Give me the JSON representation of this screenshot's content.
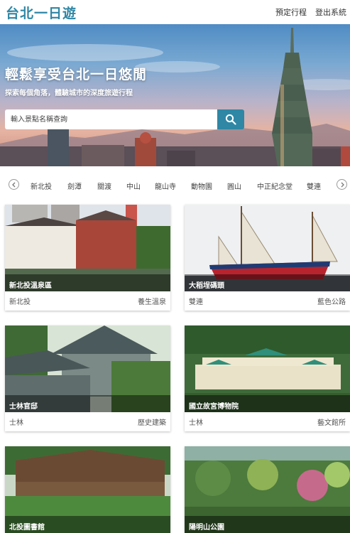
{
  "header": {
    "brand": "台北一日遊",
    "nav": [
      "預定行程",
      "登出系統"
    ]
  },
  "hero": {
    "title": "輕鬆享受台北一日悠閒",
    "subtitle": "探索每個角落，體驗城市的深度旅遊行程",
    "search_placeholder": "輸入景點名稱查詢"
  },
  "categories": [
    "新北投",
    "劍潭",
    "關渡",
    "中山",
    "龍山寺",
    "動物園",
    "圓山",
    "中正紀念堂",
    "雙連"
  ],
  "cards": [
    {
      "title": "新北投溫泉區",
      "area": "新北投",
      "tag": "養生溫泉"
    },
    {
      "title": "大稻埕碼頭",
      "area": "雙連",
      "tag": "藍色公路"
    },
    {
      "title": "士林官邸",
      "area": "士林",
      "tag": "歷史建築"
    },
    {
      "title": "國立故宮博物院",
      "area": "士林",
      "tag": "藝文館所"
    },
    {
      "title": "北投圖書館",
      "area": "",
      "tag": ""
    },
    {
      "title": "陽明山公園",
      "area": "",
      "tag": ""
    }
  ],
  "colors": {
    "accent": "#2f87a5"
  },
  "icons": {
    "search": "search-icon",
    "prev": "chevron-left-icon",
    "next": "chevron-right-icon"
  }
}
